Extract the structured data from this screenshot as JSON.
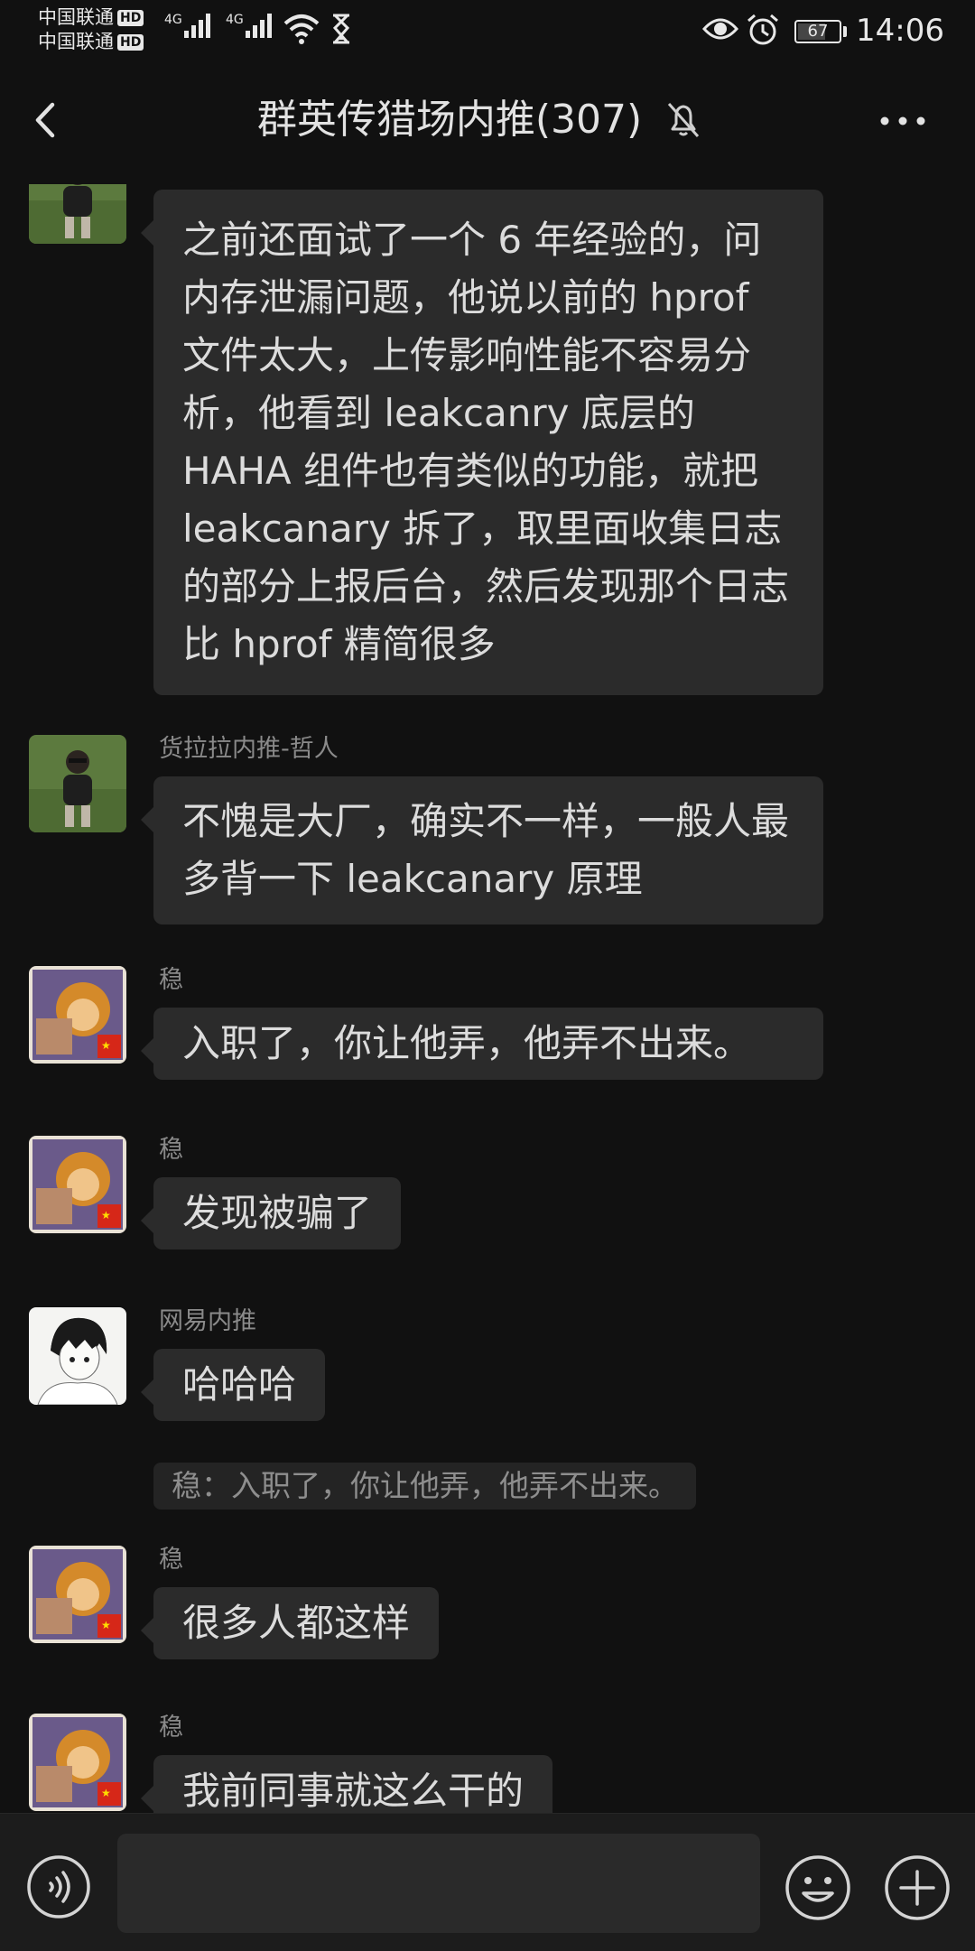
{
  "status_bar": {
    "carrier_1": "中国联通",
    "carrier_2": "中国联通",
    "hd_badge": "HD",
    "network_1": "4G",
    "network_2": "4G",
    "battery": "67",
    "time": "14:06"
  },
  "nav": {
    "title": "群英传猎场内推(307)"
  },
  "messages": [
    {
      "sender": "",
      "avatar": "photo-person-on-grass",
      "text": "之前还面试了一个 6 年经验的，问内存泄漏问题，他说以前的 hprof 文件太大，上传影响性能不容易分析，他看到 leakcanry 底层的 HAHA 组件也有类似的功能，就把 leakcanary 拆了，取里面收集日志的部分上报后台，然后发现那个日志比 hprof 精简很多"
    },
    {
      "sender": "货拉拉内推-哲人",
      "avatar": "photo-person-on-grass",
      "text": "不愧是大厂，确实不一样，一般人最多背一下 leakcanary 原理"
    },
    {
      "sender": "稳",
      "avatar": "monkey-king",
      "text": "入职了，你让他弄，他弄不出来。"
    },
    {
      "sender": "稳",
      "avatar": "monkey-king",
      "text": "发现被骗了"
    },
    {
      "sender": "网易内推",
      "avatar": "anime-boy-sketch",
      "text": "哈哈哈",
      "quote": "稳：入职了，你让他弄，他弄不出来。"
    },
    {
      "sender": "稳",
      "avatar": "monkey-king",
      "text": "很多人都这样"
    },
    {
      "sender": "稳",
      "avatar": "monkey-king",
      "text": "我前同事就这么干的"
    }
  ],
  "icons": {
    "back": "chevron-left-icon",
    "mute": "bell-off-icon",
    "more": "more-dots-icon",
    "voice": "voice-icon",
    "emoji": "emoji-icon",
    "plus": "plus-icon"
  },
  "colors": {
    "background": "#111111",
    "bubble": "#2b2b2b",
    "quote": "#242424",
    "input_bar": "#1c1c1c",
    "text": "#dcdcdc",
    "secondary_text": "#8a8a8a"
  }
}
